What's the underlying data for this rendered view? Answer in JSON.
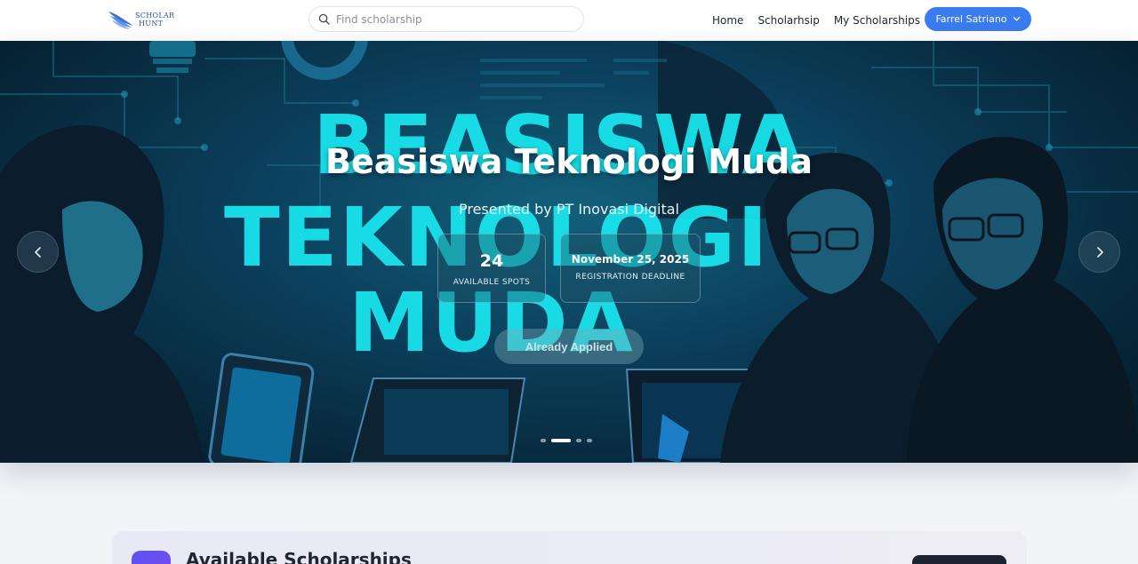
{
  "navbar": {
    "logo_text_line1": "SCHOLAR",
    "logo_text_line2": "HUNT",
    "search_placeholder": "Find scholarship",
    "links": [
      "Home",
      "Scholarhsip",
      "My Scholarships"
    ],
    "user_name": "Farrel Satriano"
  },
  "hero": {
    "background_words": [
      "BEASISWA",
      "TEKNOLOGI",
      "MUDA"
    ],
    "title": "Beasiswa Teknologi Muda",
    "subtitle": "Presented by PT Inovasi Digital",
    "stats": [
      {
        "value": "24",
        "label": "AVAILABLE SPOTS"
      },
      {
        "value": "November 25, 2025",
        "label": "REGISTRATION DEADLINE"
      }
    ],
    "action_label": "Already Applied",
    "carousel_total_slides": 4,
    "carousel_active_index": 1
  },
  "section": {
    "title": "Available Scholarships"
  },
  "colors": {
    "primary": "#3a7bf0",
    "hero_accent": "#19e8f0",
    "section_icon": "#5b52ef",
    "dark_button": "#1c2433"
  },
  "icons": {
    "search": "search-icon",
    "dropdown": "chevron-down-icon",
    "prev": "chevron-left-icon",
    "next": "chevron-right-icon"
  }
}
